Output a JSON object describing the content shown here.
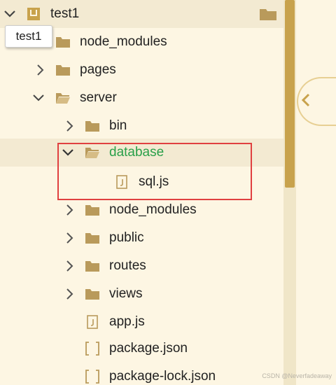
{
  "project": {
    "name": "test1",
    "tooltip": "test1"
  },
  "tree": {
    "node_modules": "node_modules",
    "pages": "pages",
    "server": "server",
    "bin": "bin",
    "database": "database",
    "sql_js": "sql.js",
    "server_node_modules": "node_modules",
    "public": "public",
    "routes": "routes",
    "views": "views",
    "app_js": "app.js",
    "package_json": "package.json",
    "package_lock_json": "package-lock.json"
  },
  "colors": {
    "accent": "#c8a24c",
    "folder": "#b99a5b",
    "highlight_text": "#2aa04a",
    "annotation": "#e04040"
  },
  "watermark": "CSDN @Neverfadeaway"
}
